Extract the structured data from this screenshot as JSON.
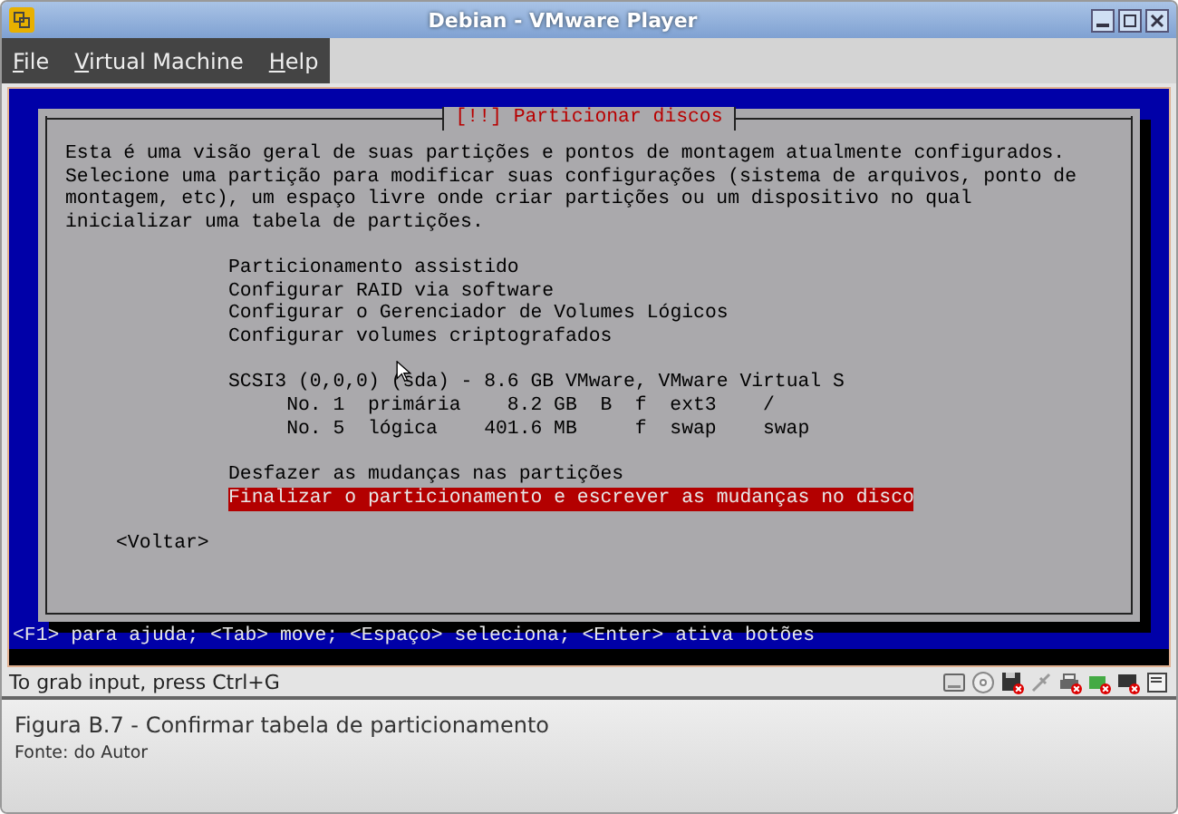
{
  "window": {
    "title": "Debian - VMware Player"
  },
  "menu": [
    {
      "label": "File"
    },
    {
      "label": "Virtual Machine"
    },
    {
      "label": "Help"
    }
  ],
  "dialog": {
    "title": "[!!] Particionar discos",
    "intro": "Esta é uma visão geral de suas partições e pontos de montagem atualmente configurados. Selecione uma partição para modificar suas configurações (sistema de arquivos, ponto de montagem, etc), um espaço livre onde criar partições ou um dispositivo no qual inicializar uma tabela de partições.",
    "options_top": [
      {
        "label": "Particionamento assistido",
        "selected": false
      },
      {
        "label": "Configurar RAID via software",
        "selected": false
      },
      {
        "label": "Configurar o Gerenciador de Volumes Lógicos",
        "selected": false
      },
      {
        "label": "Configurar volumes criptografados",
        "selected": false
      }
    ],
    "disk": {
      "label": "SCSI3 (0,0,0) (sda) - 8.6 GB VMware, VMware Virtual S",
      "partitions": [
        {
          "number": "No. 1",
          "type": "primária",
          "size": "8.2 GB",
          "bootable": "B",
          "format": "f",
          "filesystem": "ext3",
          "mount": "/"
        },
        {
          "number": "No. 5",
          "type": "lógica",
          "size": "401.6 MB",
          "format": "f",
          "filesystem": "swap",
          "mount": "swap"
        }
      ]
    },
    "options_bottom": [
      {
        "label": "Desfazer as mudanças nas partições",
        "selected": false
      },
      {
        "label": "Finalizar o particionamento e escrever as mudanças no disco",
        "selected": true
      }
    ],
    "back_button": "<Voltar>"
  },
  "help_line": "<F1> para ajuda; <Tab> move; <Espaço> seleciona; <Enter> ativa botões",
  "status_bar": {
    "text": "To grab input, press Ctrl+G"
  },
  "caption": {
    "title": "Figura B.7 - Confirmar tabela de particionamento",
    "source": "Fonte: do Autor"
  }
}
